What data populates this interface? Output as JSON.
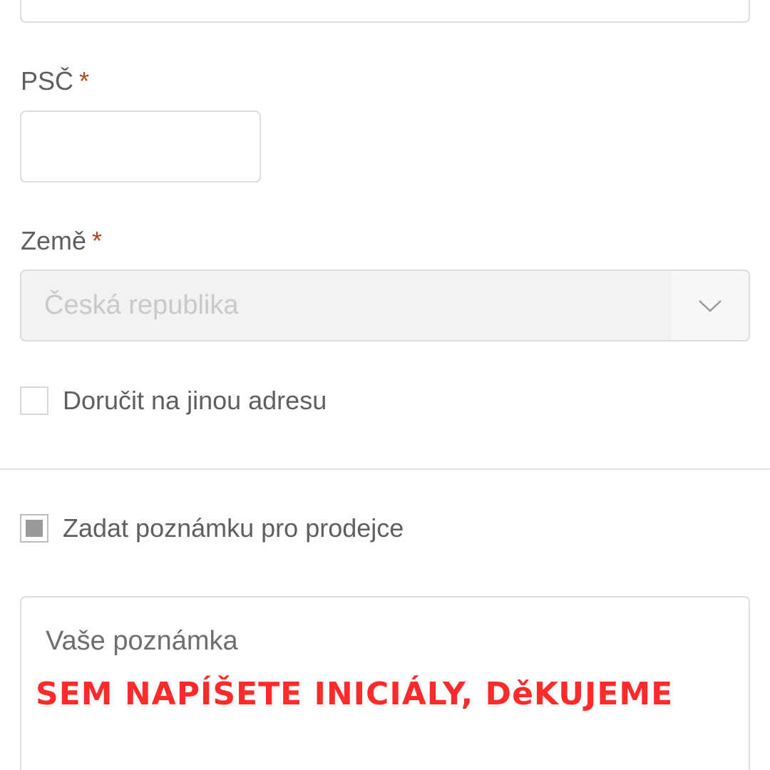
{
  "address": {
    "psc_label": "PSČ",
    "psc_value": "",
    "required_mark": "*",
    "country_label": "Země",
    "country_value": "Česká republika"
  },
  "options": {
    "ship_different_label": "Doručit na jinou adresu",
    "ship_different_checked": false,
    "note_toggle_label": "Zadat poznámku pro prodejce",
    "note_toggle_checked": true
  },
  "note": {
    "placeholder": "Vaše poznámka",
    "value": ""
  },
  "overlay": {
    "text": "SEM NAPÍŠETE INICIÁLY, DěKUJEME",
    "color": "#ff2a2a"
  }
}
